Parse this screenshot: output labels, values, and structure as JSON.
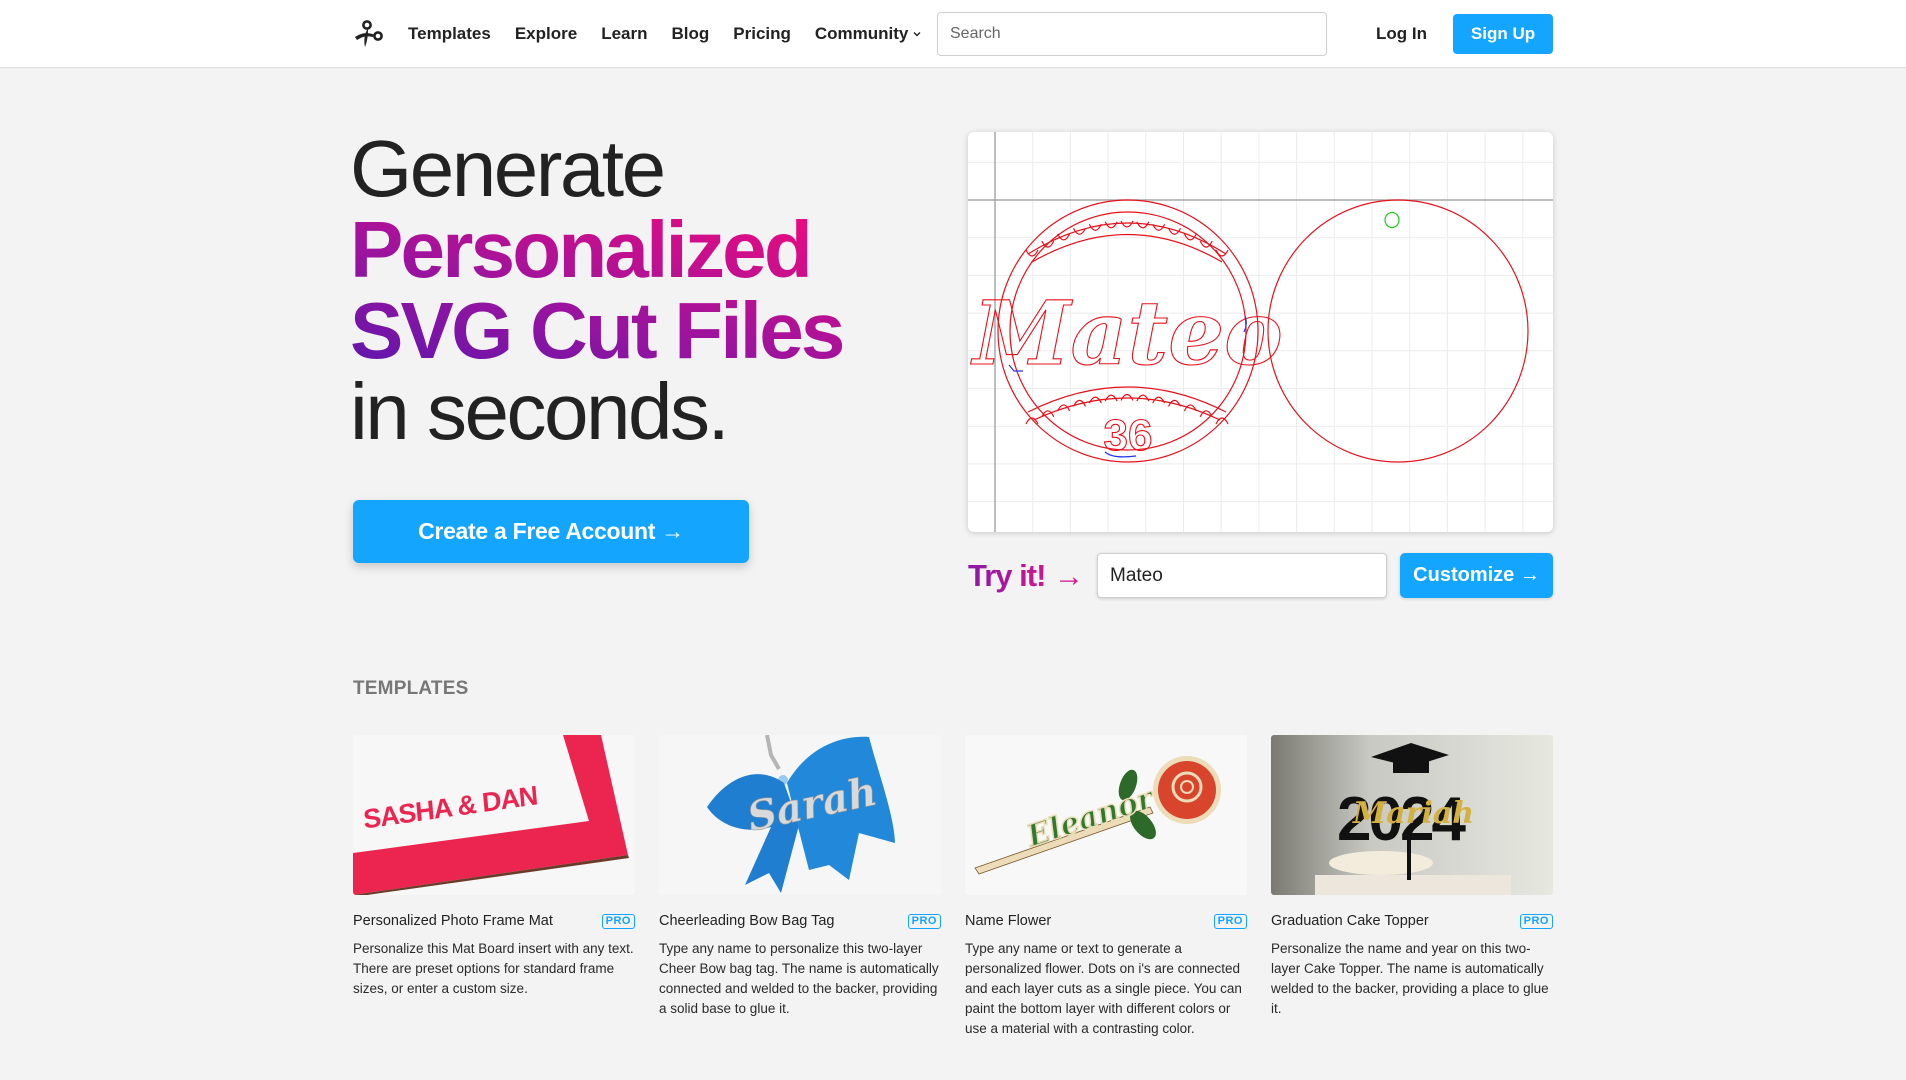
{
  "nav": {
    "logo_icon": "scissors-icon",
    "links": [
      {
        "label": "Templates"
      },
      {
        "label": "Explore"
      },
      {
        "label": "Learn"
      },
      {
        "label": "Blog"
      },
      {
        "label": "Pricing"
      },
      {
        "label": "Community",
        "has_dropdown": true
      }
    ],
    "search_placeholder": "Search",
    "search_value": "",
    "login_label": "Log In",
    "signup_label": "Sign Up"
  },
  "hero": {
    "line1": "Generate",
    "line2": "Personalized",
    "line3": "SVG Cut Files",
    "line4": "in seconds.",
    "cta_label": "Create a Free Account →",
    "gradient_colors": [
      "#5e16ad",
      "#f40a7b"
    ]
  },
  "preview": {
    "name_text": "Mateo",
    "number_text": "36",
    "cut_color": "#e8101a",
    "hole_color": "#22cc22",
    "weld_color": "#2233ee"
  },
  "try": {
    "label": "Try it!",
    "arrow": "→",
    "input_value": "Mateo",
    "button_label": "Customize →"
  },
  "templates": {
    "section_label": "TEMPLATES",
    "badge_label": "PRO",
    "items": [
      {
        "title": "Personalized Photo Frame Mat",
        "badge": "PRO",
        "image_text": "SASHA & DAN",
        "description": "Personalize this Mat Board insert with any text. There are preset options for standard frame sizes, or enter a custom size."
      },
      {
        "title": "Cheerleading Bow Bag Tag",
        "badge": "PRO",
        "image_text": "Sarah",
        "description": "Type any name to personalize this two-layer Cheer Bow bag tag. The name is automatically connected and welded to the backer, providing a solid base to glue it."
      },
      {
        "title": "Name Flower",
        "badge": "PRO",
        "image_text": "Eleanor",
        "description": "Type any name or text to generate a personalized flower. Dots on i's are connected and each layer cuts as a single piece. You can paint the bottom layer with different colors or use a material with a contrasting color."
      },
      {
        "title": "Graduation Cake Topper",
        "badge": "PRO",
        "image_text_year": "2024",
        "image_text_name": "Mariah",
        "description": "Personalize the name and year on this two-layer Cake Topper. The name is automatically welded to the backer, providing a place to glue it."
      }
    ]
  },
  "colors": {
    "accent": "#14a6ff",
    "background": "#f3f3f3",
    "text": "#222222",
    "section_label": "#777777"
  }
}
